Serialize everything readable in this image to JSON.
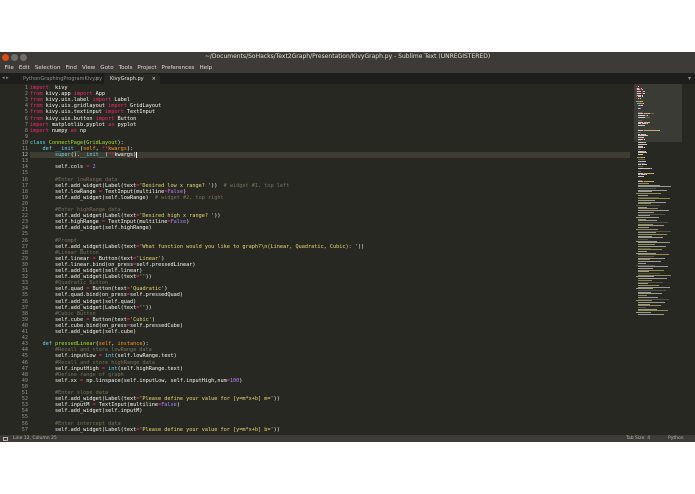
{
  "window": {
    "title": "~/Documents/SoHacks/Text2Graph/Presentation/KivyGraph.py - Sublime Text (UNREGISTERED)"
  },
  "menu": [
    "File",
    "Edit",
    "Selection",
    "Find",
    "View",
    "Goto",
    "Tools",
    "Project",
    "Preferences",
    "Help"
  ],
  "tabs": [
    {
      "label": "PythonGraphingProgramKivy.py",
      "active": false
    },
    {
      "label": "KivyGraph.py",
      "active": true
    }
  ],
  "editor": {
    "first_line_number": 1,
    "current_line": 12,
    "lines": [
      [
        [
          "kw",
          "import"
        ],
        [
          "",
          "  kivy"
        ]
      ],
      [
        [
          "kw",
          "from"
        ],
        [
          "",
          " kivy.app "
        ],
        [
          "kw",
          "import"
        ],
        [
          "",
          " App"
        ]
      ],
      [
        [
          "kw",
          "from"
        ],
        [
          "",
          " kivy.uix.label "
        ],
        [
          "kw",
          "import"
        ],
        [
          "",
          " Label"
        ]
      ],
      [
        [
          "kw",
          "from"
        ],
        [
          "",
          " kivy.uix.gridlayout "
        ],
        [
          "kw",
          "import"
        ],
        [
          "",
          " GridLayout"
        ]
      ],
      [
        [
          "kw",
          "from"
        ],
        [
          "",
          " kivy.uix.textinput "
        ],
        [
          "kw",
          "import"
        ],
        [
          "",
          " TextInput"
        ]
      ],
      [
        [
          "kw",
          "from"
        ],
        [
          "",
          " kivy.uix.button "
        ],
        [
          "kw",
          "import"
        ],
        [
          "",
          " Button"
        ]
      ],
      [
        [
          "kw",
          "import"
        ],
        [
          "",
          " matplotlib.pyplot "
        ],
        [
          "kw",
          "as"
        ],
        [
          "",
          " pyplot"
        ]
      ],
      [
        [
          "kw",
          "import"
        ],
        [
          "",
          " numpy "
        ],
        [
          "kw",
          "as"
        ],
        [
          "",
          " np"
        ]
      ],
      [],
      [
        [
          "df",
          "class"
        ],
        [
          "",
          " "
        ],
        [
          "fn",
          "ConnectPage"
        ],
        [
          "",
          "("
        ],
        [
          "fn",
          "GridLayout"
        ],
        [
          "",
          "):"
        ]
      ],
      [
        [
          "",
          "    "
        ],
        [
          "df",
          "def"
        ],
        [
          "",
          " "
        ],
        [
          "bi",
          "__init__"
        ],
        [
          "",
          "("
        ],
        [
          "sf",
          "self"
        ],
        [
          "",
          ", "
        ],
        [
          "kw",
          "**"
        ],
        [
          "sf",
          "kwargs"
        ],
        [
          "",
          "):"
        ]
      ],
      [
        [
          "",
          "        "
        ],
        [
          "bi",
          "super"
        ],
        [
          "",
          "()."
        ],
        [
          "bi",
          "__init__"
        ],
        [
          "",
          "("
        ],
        [
          "kw",
          "**"
        ],
        [
          "",
          "kwargs)"
        ]
      ],
      [],
      [
        [
          "",
          "        self.cols "
        ],
        [
          "kw",
          "="
        ],
        [
          "",
          " "
        ],
        [
          "nu",
          "2"
        ]
      ],
      [],
      [
        [
          "cm",
          "        #Enter lowRange data"
        ]
      ],
      [
        [
          "",
          "        self.add_widget(Label(text"
        ],
        [
          "kw",
          "="
        ],
        [
          "st",
          "'Desired low x range? '"
        ],
        [
          "",
          "))  "
        ],
        [
          "cm",
          "# widget #1, top left"
        ]
      ],
      [
        [
          "",
          "        self.lowRange "
        ],
        [
          "kw",
          "="
        ],
        [
          "",
          " TextInput(multiline"
        ],
        [
          "kw",
          "="
        ],
        [
          "nu",
          "False"
        ],
        [
          "",
          ")"
        ]
      ],
      [
        [
          "",
          "        self.add_widget(self.lowRange) "
        ],
        [
          "cm",
          " # widget #2, top right"
        ]
      ],
      [],
      [
        [
          "cm",
          "        #Enter highRange data"
        ]
      ],
      [
        [
          "",
          "        self.add_widget(Label(text"
        ],
        [
          "kw",
          "="
        ],
        [
          "st",
          "'Desired high x range? '"
        ],
        [
          "",
          "))"
        ]
      ],
      [
        [
          "",
          "        self.highRange "
        ],
        [
          "kw",
          "="
        ],
        [
          "",
          " TextInput(multiline"
        ],
        [
          "kw",
          "="
        ],
        [
          "nu",
          "False"
        ],
        [
          "",
          ")"
        ]
      ],
      [
        [
          "",
          "        self.add_widget(self.highRange)"
        ]
      ],
      [],
      [
        [
          "cm",
          "        #Prompt"
        ]
      ],
      [
        [
          "",
          "        self.add_widget(Label(text"
        ],
        [
          "kw",
          "="
        ],
        [
          "st",
          "'What function would you like to graph?\\n(Linear, Quadratic, Cubic): '"
        ],
        [
          "",
          "))"
        ]
      ],
      [
        [
          "cm",
          "        #Linear Button"
        ]
      ],
      [
        [
          "",
          "        self.linear "
        ],
        [
          "kw",
          "="
        ],
        [
          "",
          " Button(text"
        ],
        [
          "kw",
          "="
        ],
        [
          "st",
          "'Linear'"
        ],
        [
          "",
          ")"
        ]
      ],
      [
        [
          "",
          "        self.linear.bind(on_press"
        ],
        [
          "kw",
          "="
        ],
        [
          "",
          "self.pressedLinear)"
        ]
      ],
      [
        [
          "",
          "        self.add_widget(self.linear)"
        ]
      ],
      [
        [
          "",
          "        self.add_widget(Label(text"
        ],
        [
          "kw",
          "="
        ],
        [
          "st",
          "''"
        ],
        [
          "",
          "))"
        ]
      ],
      [
        [
          "cm",
          "        #Quadratic Button"
        ]
      ],
      [
        [
          "",
          "        self.quad "
        ],
        [
          "kw",
          "="
        ],
        [
          "",
          " Button(text"
        ],
        [
          "kw",
          "="
        ],
        [
          "st",
          "'Quadratic'"
        ],
        [
          "",
          ")"
        ]
      ],
      [
        [
          "",
          "        self.quad.bind(on_press"
        ],
        [
          "kw",
          "="
        ],
        [
          "",
          "self.pressedQuad)"
        ]
      ],
      [
        [
          "",
          "        self.add_widget(self.quad)"
        ]
      ],
      [
        [
          "",
          "        self.add_widget(Label(text"
        ],
        [
          "kw",
          "="
        ],
        [
          "st",
          "''"
        ],
        [
          "",
          "))"
        ]
      ],
      [
        [
          "cm",
          "        #Cubic Button"
        ]
      ],
      [
        [
          "",
          "        self.cube "
        ],
        [
          "kw",
          "="
        ],
        [
          "",
          " Button(text"
        ],
        [
          "kw",
          "="
        ],
        [
          "st",
          "'Cubic'"
        ],
        [
          "",
          ")"
        ]
      ],
      [
        [
          "",
          "        self.cube.bind(on_press"
        ],
        [
          "kw",
          "="
        ],
        [
          "",
          "self.pressedCube)"
        ]
      ],
      [
        [
          "",
          "        self.add_widget(self.cube)"
        ]
      ],
      [],
      [
        [
          "",
          "    "
        ],
        [
          "df",
          "def"
        ],
        [
          "",
          " "
        ],
        [
          "fn",
          "pressedLinear"
        ],
        [
          "",
          "("
        ],
        [
          "sf",
          "self"
        ],
        [
          "",
          ", "
        ],
        [
          "sf",
          "instance"
        ],
        [
          "",
          "):"
        ]
      ],
      [
        [
          "cm",
          "        #Recall and store lowRange data"
        ]
      ],
      [
        [
          "",
          "        self.inputLow "
        ],
        [
          "kw",
          "="
        ],
        [
          "",
          " "
        ],
        [
          "bi",
          "int"
        ],
        [
          "",
          "(self.lowRange.text)"
        ]
      ],
      [
        [
          "cm",
          "        #Recall and store highRange data"
        ]
      ],
      [
        [
          "",
          "        self.inputHigh "
        ],
        [
          "kw",
          "="
        ],
        [
          "",
          " "
        ],
        [
          "bi",
          "int"
        ],
        [
          "",
          "(self.highRange.text)"
        ]
      ],
      [
        [
          "cm",
          "        #Define range of graph"
        ]
      ],
      [
        [
          "",
          "        self.xx "
        ],
        [
          "kw",
          "="
        ],
        [
          "",
          " np.linspace(self.inputLow, self.inputHigh,num"
        ],
        [
          "kw",
          "="
        ],
        [
          "nu",
          "100"
        ],
        [
          "",
          ")"
        ]
      ],
      [],
      [
        [
          "cm",
          "        #Enter slope data"
        ]
      ],
      [
        [
          "",
          "        self.add_widget(Label(text"
        ],
        [
          "kw",
          "="
        ],
        [
          "st",
          "'Please define your value for [y=m*x+b] m='"
        ],
        [
          "",
          "))"
        ]
      ],
      [
        [
          "",
          "        self.inputM "
        ],
        [
          "kw",
          "="
        ],
        [
          "",
          " TextInput(multiline"
        ],
        [
          "kw",
          "="
        ],
        [
          "nu",
          "False"
        ],
        [
          "",
          ")"
        ]
      ],
      [
        [
          "",
          "        self.add_widget(self.inputM)"
        ]
      ],
      [],
      [
        [
          "cm",
          "        #Enter intercept data"
        ]
      ],
      [
        [
          "",
          "        self.add_widget(Label(text"
        ],
        [
          "kw",
          "="
        ],
        [
          "st",
          "'Please define your value for [y=m*x+b] b='"
        ],
        [
          "",
          "))"
        ]
      ]
    ]
  },
  "status": {
    "position": "Line 12, Column 25",
    "tab_size": "Tab Size: 4",
    "syntax": "Python"
  },
  "colors": {
    "editor_bg": "#272822",
    "chrome_bg": "#3c3b37",
    "keyword": "#f92672",
    "string": "#e6db74",
    "comment": "#75715e",
    "function": "#a6e22e",
    "number": "#ae81ff"
  },
  "icons": {
    "window_controls": [
      "close-icon",
      "minimize-icon",
      "maximize-icon"
    ],
    "tab_close": "close-icon",
    "tab_nav": "chevron-left-right-icon",
    "tab_menu": "chevron-down-icon",
    "status_panel": "panel-toggle-icon"
  }
}
